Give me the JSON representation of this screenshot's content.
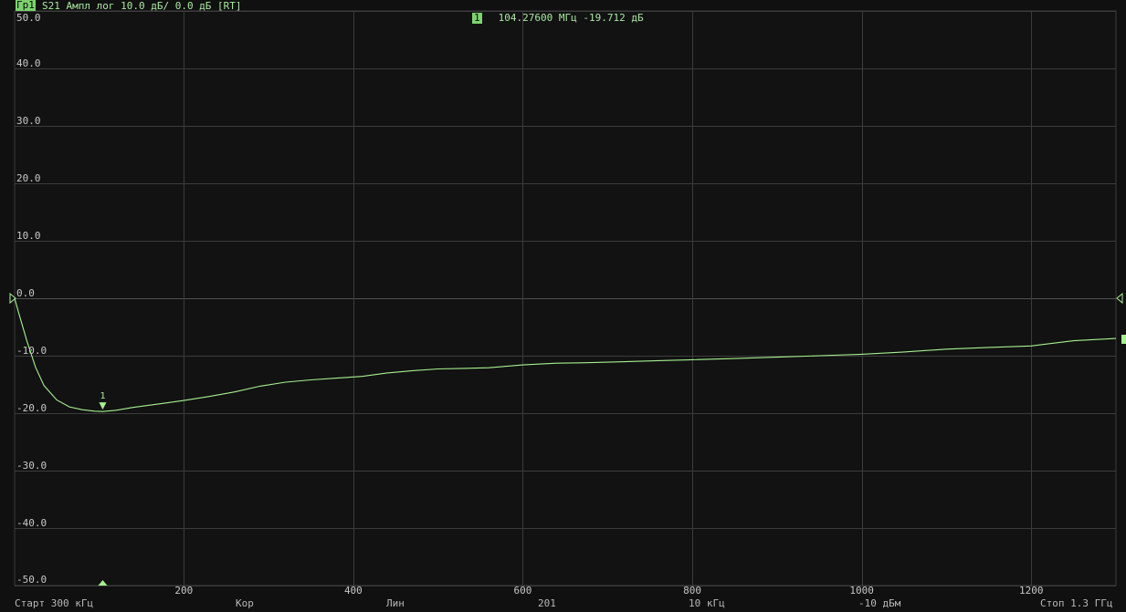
{
  "header": {
    "trace_tag": "Гр1",
    "trace_desc": "S21 Ампл лог 10.0 дБ/ 0.0 дБ [RT]"
  },
  "marker_readout": {
    "index": "1",
    "frequency": "104.27600 МГц",
    "value": "-19.712 дБ"
  },
  "footer": {
    "start": "Старт 300 кГц",
    "format": "Кор",
    "sweep_type": "Лин",
    "points": "201",
    "ifbw": "10 кГц",
    "power": "-10 дБм",
    "stop": "Стоп 1.3 ГГц"
  },
  "colors": {
    "trace": "#a6f08e",
    "grid": "#3c3c3c",
    "axis_text": "#c8c8c8",
    "marker": "#a6f08e"
  },
  "chart_data": {
    "type": "line",
    "title": "",
    "xlabel": "",
    "ylabel": "",
    "xlim": [
      0.3,
      1300
    ],
    "ylim": [
      -50,
      50
    ],
    "y_ticks": [
      "50.0",
      "40.0",
      "30.0",
      "20.0",
      "10.0",
      "0.0",
      "-10.0",
      "-20.0",
      "-30.0",
      "-40.0",
      "-50.0"
    ],
    "x_ticks": [
      "200",
      "400",
      "600",
      "800",
      "1000",
      "1200"
    ],
    "grid": true,
    "reference_level": 0.0,
    "marker": {
      "label": "1",
      "x": 104.276,
      "y": -19.712
    },
    "series": [
      {
        "name": "S21",
        "x": [
          0.3,
          5,
          15,
          25,
          35,
          50,
          65,
          80,
          95,
          104.3,
          120,
          140,
          160,
          180,
          200,
          230,
          260,
          290,
          320,
          350,
          380,
          410,
          440,
          470,
          500,
          530,
          560,
          600,
          640,
          680,
          720,
          760,
          800,
          850,
          900,
          950,
          1000,
          1050,
          1100,
          1150,
          1200,
          1250,
          1300
        ],
        "y": [
          0.0,
          -2.5,
          -7.5,
          -12.0,
          -15.2,
          -17.7,
          -18.9,
          -19.4,
          -19.65,
          -19.71,
          -19.5,
          -19.0,
          -18.6,
          -18.2,
          -17.8,
          -17.1,
          -16.3,
          -15.3,
          -14.6,
          -14.2,
          -13.9,
          -13.6,
          -13.0,
          -12.6,
          -12.3,
          -12.2,
          -12.1,
          -11.6,
          -11.3,
          -11.2,
          -11.05,
          -10.85,
          -10.7,
          -10.5,
          -10.25,
          -10.0,
          -9.75,
          -9.35,
          -8.85,
          -8.55,
          -8.3,
          -7.4,
          -7.0
        ]
      }
    ]
  }
}
